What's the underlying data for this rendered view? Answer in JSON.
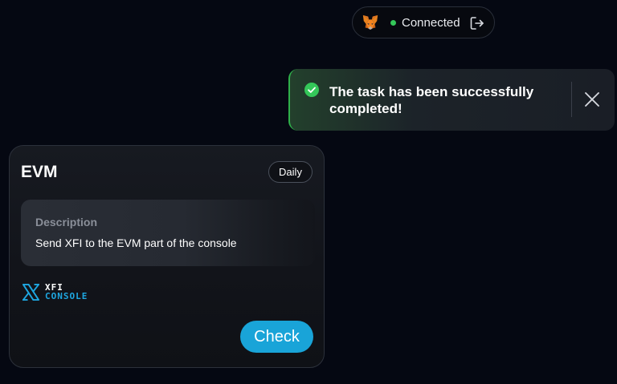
{
  "header": {
    "wallet": {
      "icon": "metamask-fox-icon",
      "status_label": "Connected",
      "status_color": "#34c759",
      "logout_icon": "logout-icon"
    }
  },
  "toast": {
    "type": "success",
    "icon": "check-circle-icon",
    "accent_color": "#2fb04a",
    "message": "The task has been successfully completed!",
    "close_icon": "close-icon"
  },
  "task_card": {
    "title": "EVM",
    "frequency_badge": "Daily",
    "description": {
      "heading": "Description",
      "text": "Send XFI to the EVM part of the console"
    },
    "logo": {
      "line1": "XFI",
      "line2": "CONSOLE",
      "accent_color": "#1ea7e1"
    },
    "action_button": {
      "label": "Check",
      "color": "#19a4d8"
    }
  }
}
